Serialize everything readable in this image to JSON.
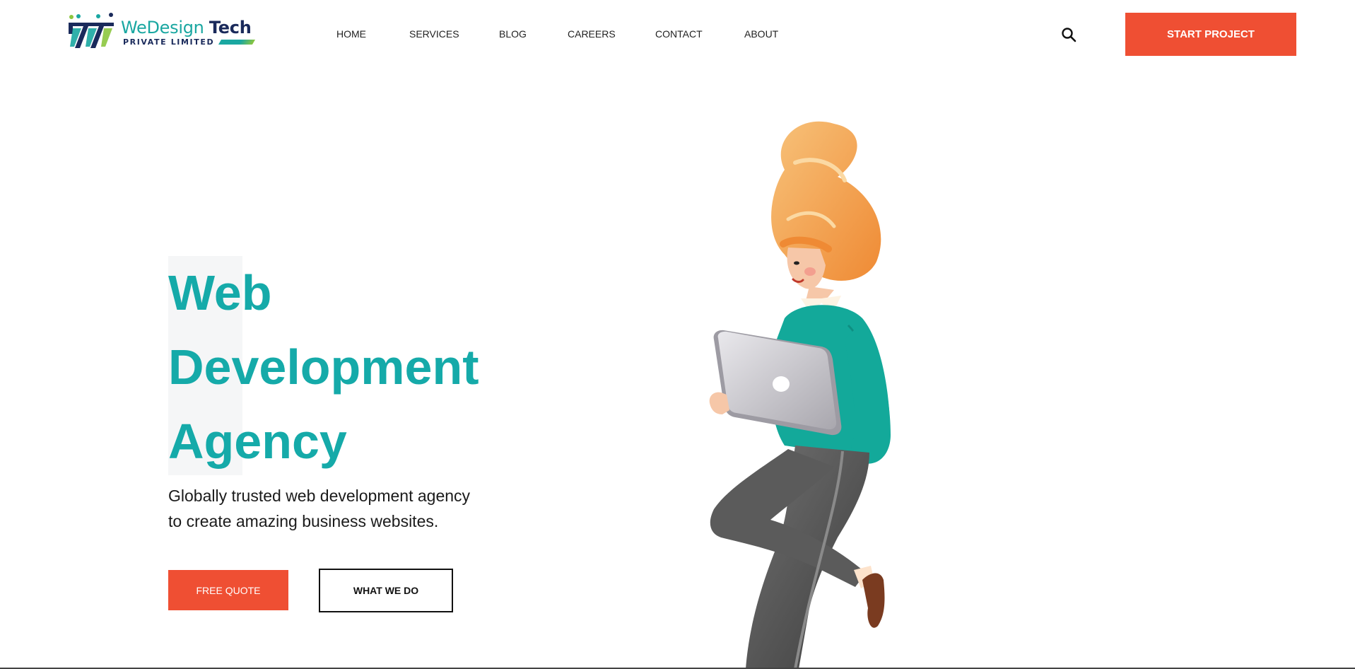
{
  "brand": {
    "name_part1": "WeDesign",
    "name_part2": "Tech",
    "subtitle": "PRIVATE LIMITED",
    "primary_color": "#1aa7a1",
    "secondary_color": "#1a2a5b",
    "accent_color": "#8cc63f"
  },
  "nav": {
    "items": [
      {
        "label": "HOME"
      },
      {
        "label": "SERVICES"
      },
      {
        "label": "BLOG"
      },
      {
        "label": "CAREERS"
      },
      {
        "label": "CONTACT"
      },
      {
        "label": "ABOUT"
      }
    ]
  },
  "header": {
    "search_icon": "search-icon",
    "cta_label": "START PROJECT",
    "cta_color": "#ef4f33"
  },
  "hero": {
    "title_lines": [
      "Web",
      "Development",
      "Agency"
    ],
    "title_color": "#15aaa9",
    "subtitle_lines": [
      "Globally trusted web development agency",
      "to create amazing business websites."
    ],
    "primary_button": "FREE QUOTE",
    "secondary_button": "WHAT WE DO",
    "illustration": "woman-with-laptop-illustration"
  }
}
